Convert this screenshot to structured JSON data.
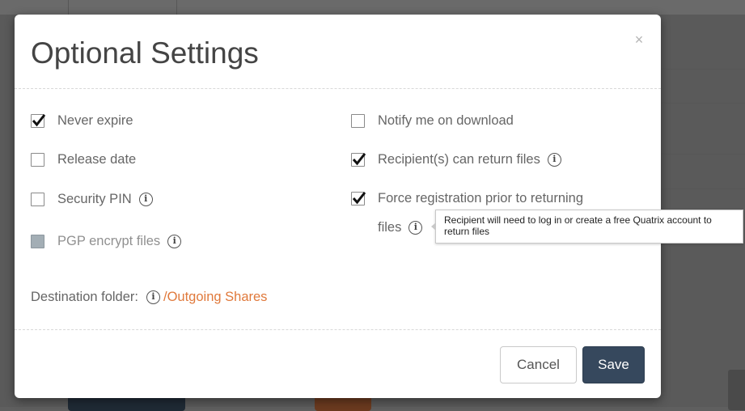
{
  "modal": {
    "title": "Optional Settings",
    "close_symbol": "×",
    "left_options": [
      {
        "label": "Never expire",
        "checked": true,
        "disabled": false,
        "info": false
      },
      {
        "label": "Release date",
        "checked": false,
        "disabled": false,
        "info": false
      },
      {
        "label": "Security PIN",
        "checked": false,
        "disabled": false,
        "info": true
      },
      {
        "label": "PGP encrypt files",
        "checked": false,
        "disabled": true,
        "info": true
      }
    ],
    "right_options": [
      {
        "label": "Notify me on download",
        "checked": false,
        "info": false
      },
      {
        "label": "Recipient(s) can return files",
        "checked": true,
        "info": true
      },
      {
        "label_line1": "Force registration prior to returning",
        "label_line2": "files",
        "checked": true,
        "info": true
      }
    ],
    "destination": {
      "label": "Destination folder:",
      "folder": "/Outgoing Shares"
    },
    "buttons": {
      "cancel": "Cancel",
      "save": "Save"
    },
    "tooltip": "Recipient will need to log in or create a free Quatrix account to return files"
  },
  "colors": {
    "accent_link": "#e0793b",
    "save_button": "#36485d"
  },
  "icons": {
    "info": "info-icon",
    "checkmark": "checkmark-icon",
    "close": "close-icon"
  }
}
